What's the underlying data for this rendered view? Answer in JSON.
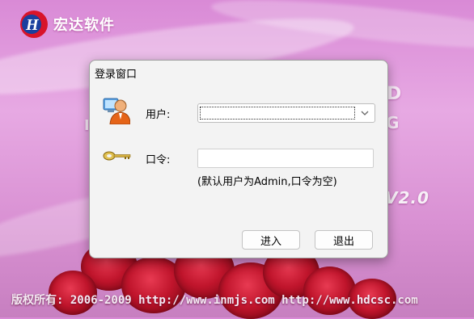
{
  "app": {
    "title": "宏达软件",
    "logo_letter": "H",
    "version": "V2.0",
    "background_letters": [
      "I",
      "G",
      "D"
    ]
  },
  "footer": {
    "copyright": "版权所有: 2006-2009  http://www.inmjs.com http://www.hdcsc.com"
  },
  "dialog": {
    "title": "登录窗口",
    "user_label": "用户:",
    "user_value": "",
    "password_label": "口令:",
    "password_value": "",
    "hint": "(默认用户为Admin,口令为空)",
    "login_button": "进入",
    "exit_button": "退出"
  },
  "colors": {
    "background": "#dd94d8",
    "dialog_background": "#f3f3f3",
    "logo_red": "#d8142a",
    "logo_blue": "#1a3f9e",
    "rose_red": "#c0152c"
  },
  "icons": [
    "app-logo-icon",
    "user-icon",
    "key-icon",
    "chevron-down-icon"
  ]
}
